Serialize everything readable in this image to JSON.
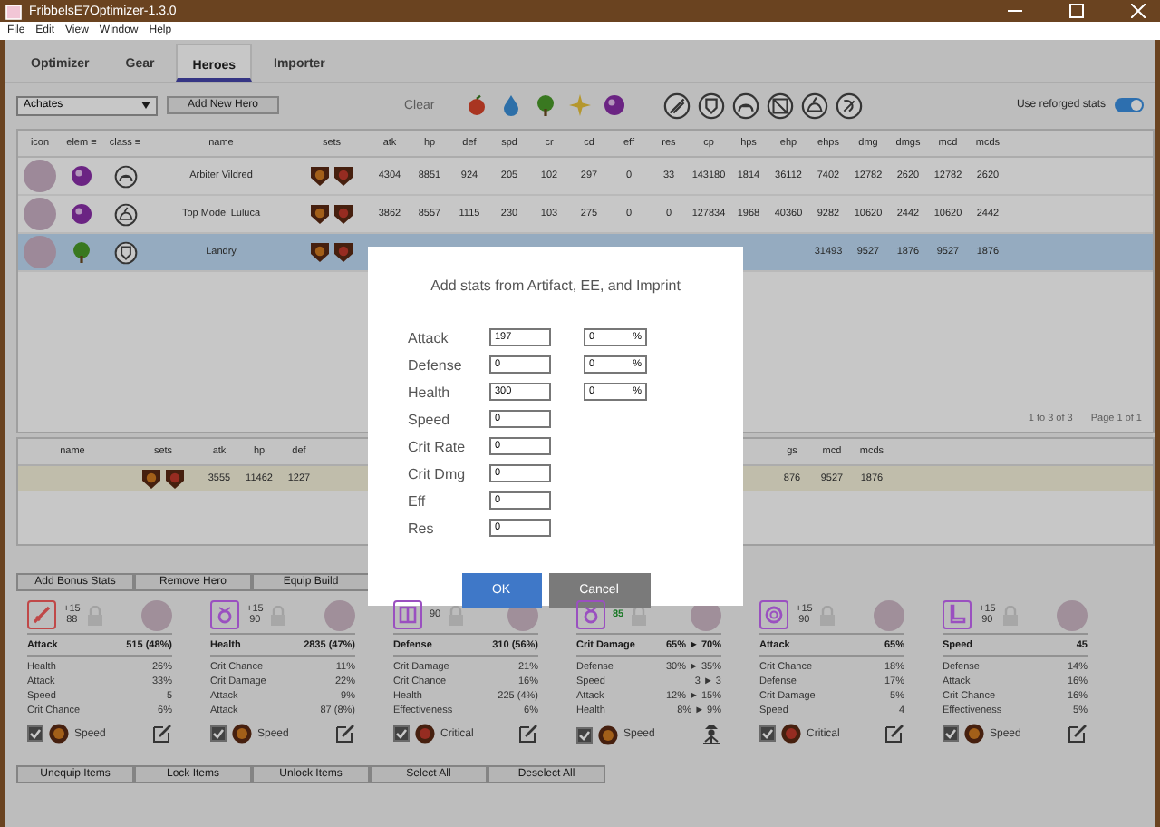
{
  "window": {
    "title": "FribbelsE7Optimizer-1.3.0"
  },
  "menu": [
    "File",
    "Edit",
    "View",
    "Window",
    "Help"
  ],
  "tabs": [
    {
      "label": "Optimizer",
      "selected": false
    },
    {
      "label": "Gear",
      "selected": false
    },
    {
      "label": "Heroes",
      "selected": true
    },
    {
      "label": "Importer",
      "selected": false
    }
  ],
  "toolbar": {
    "hero_select": "Achates",
    "add_button": "Add New Hero",
    "clear_button": "Clear",
    "element_filters": [
      {
        "kind": "fire"
      },
      {
        "kind": "ice"
      },
      {
        "kind": "earth"
      },
      {
        "kind": "light"
      },
      {
        "kind": "dark"
      }
    ],
    "class_filters": [
      {
        "kind": "warrior"
      },
      {
        "kind": "knight"
      },
      {
        "kind": "thief"
      },
      {
        "kind": "ranger"
      },
      {
        "kind": "mage"
      },
      {
        "kind": "soulweaver"
      }
    ],
    "reforge_toggle": {
      "label": "Use reforged stats",
      "on": true
    }
  },
  "heroes_table": {
    "columns": [
      {
        "label": "icon",
        "kind": "avatar"
      },
      {
        "label": "elem ≡",
        "kind": "element"
      },
      {
        "label": "class ≡",
        "kind": "class"
      },
      {
        "label": "name",
        "kind": "name"
      },
      {
        "label": "sets",
        "kind": "sets"
      },
      {
        "label": "atk",
        "kind": "stat"
      },
      {
        "label": "hp",
        "kind": "stat"
      },
      {
        "label": "def",
        "kind": "stat"
      },
      {
        "label": "spd",
        "kind": "stat"
      },
      {
        "label": "cr",
        "kind": "stat"
      },
      {
        "label": "cd",
        "kind": "stat"
      },
      {
        "label": "eff",
        "kind": "stat"
      },
      {
        "label": "res",
        "kind": "stat"
      },
      {
        "label": "cp",
        "kind": "stat"
      },
      {
        "label": "hps",
        "kind": "stat"
      },
      {
        "label": "ehp",
        "kind": "stat"
      },
      {
        "label": "ehps",
        "kind": "stat"
      },
      {
        "label": "dmg",
        "kind": "stat"
      },
      {
        "label": "dmgs",
        "kind": "stat"
      },
      {
        "label": "mcd",
        "kind": "stat"
      },
      {
        "label": "mcds",
        "kind": "stat"
      }
    ],
    "rows": [
      {
        "name": "Arbiter Vildred",
        "element": {
          "kind": "dark"
        },
        "class": {
          "kind": "thief"
        },
        "sets": [
          {
            "kind": "speed"
          },
          {
            "kind": "critical"
          }
        ],
        "selected": false,
        "stats": [
          "4304",
          "8851",
          "924",
          "205",
          "102",
          "297",
          "0",
          "33",
          "143180",
          "1814",
          "36112",
          "7402",
          "12782",
          "2620",
          "12782",
          "2620"
        ]
      },
      {
        "name": "Top Model Luluca",
        "element": {
          "kind": "dark"
        },
        "class": {
          "kind": "mage"
        },
        "sets": [
          {
            "kind": "speed"
          },
          {
            "kind": "critical"
          }
        ],
        "selected": false,
        "stats": [
          "3862",
          "8557",
          "1115",
          "230",
          "103",
          "275",
          "0",
          "0",
          "127834",
          "1968",
          "40360",
          "9282",
          "10620",
          "2442",
          "10620",
          "2442"
        ]
      },
      {
        "name": "Landry",
        "element": {
          "kind": "earth"
        },
        "class": {
          "kind": "knight"
        },
        "sets": [
          {
            "kind": "speed"
          },
          {
            "kind": "critical"
          }
        ],
        "selected": true,
        "stats": [
          "31493",
          "9527",
          "1876",
          "9527",
          "1876"
        ]
      }
    ]
  },
  "pagination": {
    "range": "1 to 3 of 3",
    "page": "Page 1 of 1"
  },
  "build_table": {
    "columns_left": [
      {
        "label": "name",
        "kind": "text"
      },
      {
        "label": "sets",
        "kind": "sets",
        "sets": [
          {
            "kind": "speed"
          },
          {
            "kind": "critical"
          }
        ]
      },
      {
        "label": "atk",
        "kind": "text",
        "value": "3555"
      },
      {
        "label": "hp",
        "kind": "text",
        "value": "11462"
      },
      {
        "label": "def",
        "kind": "text",
        "value": "1227"
      }
    ],
    "columns_right": [
      {
        "label": "gs",
        "value": "876"
      },
      {
        "label": "mcd",
        "value": "9527"
      },
      {
        "label": "mcds",
        "value": "1876"
      }
    ]
  },
  "hero_buttons": [
    "Add Bonus Stats",
    "Remove Hero",
    "Equip Build"
  ],
  "gear_cards": [
    {
      "icon": {
        "kind": "weapon",
        "color": "#c04848"
      },
      "enhance": "+15",
      "level": "88",
      "reforgeable": false,
      "main_stat": "Attack",
      "main_value": "515 (48%)",
      "substats": [
        {
          "name": "Health",
          "value": "26%"
        },
        {
          "name": "Attack",
          "value": "33%"
        },
        {
          "name": "Speed",
          "value": "5"
        },
        {
          "name": "Crit Chance",
          "value": "6%"
        }
      ],
      "checked": true,
      "set": {
        "kind": "speed"
      },
      "set_name": "Speed",
      "action": {
        "kind": "edit"
      }
    },
    {
      "icon": {
        "kind": "necklace",
        "color": "#9a50c0"
      },
      "enhance": "+15",
      "level": "90",
      "reforgeable": false,
      "main_stat": "Health",
      "main_value": "2835 (47%)",
      "substats": [
        {
          "name": "Crit Chance",
          "value": "11%"
        },
        {
          "name": "Crit Damage",
          "value": "22%"
        },
        {
          "name": "Attack",
          "value": "9%"
        },
        {
          "name": "Attack",
          "value": "87 (8%)"
        }
      ],
      "checked": true,
      "set": {
        "kind": "speed"
      },
      "set_name": "Speed",
      "action": {
        "kind": "edit"
      }
    },
    {
      "icon": {
        "kind": "armor",
        "color": "#9a50c0"
      },
      "level": "90",
      "reforgeable": false,
      "main_stat": "Defense",
      "main_value": "310 (56%)",
      "substats": [
        {
          "name": "Crit Damage",
          "value": "21%"
        },
        {
          "name": "Crit Chance",
          "value": "16%"
        },
        {
          "name": "Health",
          "value": "225 (4%)"
        },
        {
          "name": "Effectiveness",
          "value": "6%"
        }
      ],
      "checked": true,
      "set": {
        "kind": "critical"
      },
      "set_name": "Critical",
      "action": {
        "kind": "edit"
      }
    },
    {
      "icon": {
        "kind": "necklace",
        "color": "#9a50c0"
      },
      "level": "85",
      "reforgeable": true,
      "main_stat": "Crit Damage",
      "main_value": "65% ► 70%",
      "substats": [
        {
          "name": "Defense",
          "value": "30% ► 35%"
        },
        {
          "name": "Speed",
          "value": "3 ► 3"
        },
        {
          "name": "Attack",
          "value": "12% ► 15%"
        },
        {
          "name": "Health",
          "value": "8% ► 9%"
        }
      ],
      "checked": true,
      "set": {
        "kind": "speed"
      },
      "set_name": "Speed",
      "action": {
        "kind": "reforge"
      }
    },
    {
      "icon": {
        "kind": "ring",
        "color": "#9a50c0"
      },
      "enhance": "+15",
      "level": "90",
      "reforgeable": false,
      "main_stat": "Attack",
      "main_value": "65%",
      "substats": [
        {
          "name": "Crit Chance",
          "value": "18%"
        },
        {
          "name": "Defense",
          "value": "17%"
        },
        {
          "name": "Crit Damage",
          "value": "5%"
        },
        {
          "name": "Speed",
          "value": "4"
        }
      ],
      "checked": true,
      "set": {
        "kind": "critical"
      },
      "set_name": "Critical",
      "action": {
        "kind": "edit"
      }
    },
    {
      "icon": {
        "kind": "boots",
        "color": "#9a50c0"
      },
      "enhance": "+15",
      "level": "90",
      "reforgeable": false,
      "main_stat": "Speed",
      "main_value": "45",
      "substats": [
        {
          "name": "Defense",
          "value": "14%"
        },
        {
          "name": "Attack",
          "value": "16%"
        },
        {
          "name": "Crit Chance",
          "value": "16%"
        },
        {
          "name": "Effectiveness",
          "value": "5%"
        }
      ],
      "checked": true,
      "set": {
        "kind": "speed"
      },
      "set_name": "Speed",
      "action": {
        "kind": "edit"
      }
    }
  ],
  "item_buttons": [
    "Unequip Items",
    "Lock Items",
    "Unlock Items",
    "Select All",
    "Deselect All"
  ],
  "dialog": {
    "title": "Add stats from Artifact, EE, and Imprint",
    "fields": [
      {
        "label": "Attack",
        "value": "197",
        "percent": {
          "value": "0",
          "unit": "%"
        }
      },
      {
        "label": "Defense",
        "value": "0",
        "percent": {
          "value": "0",
          "unit": "%"
        }
      },
      {
        "label": "Health",
        "value": "300",
        "percent": {
          "value": "0",
          "unit": "%"
        }
      },
      {
        "label": "Speed",
        "value": "0"
      },
      {
        "label": "Crit Rate",
        "value": "0"
      },
      {
        "label": "Crit Dmg",
        "value": "0"
      },
      {
        "label": "Eff",
        "value": "0"
      },
      {
        "label": "Res",
        "value": "0"
      }
    ],
    "ok": "OK",
    "cancel": "Cancel"
  }
}
